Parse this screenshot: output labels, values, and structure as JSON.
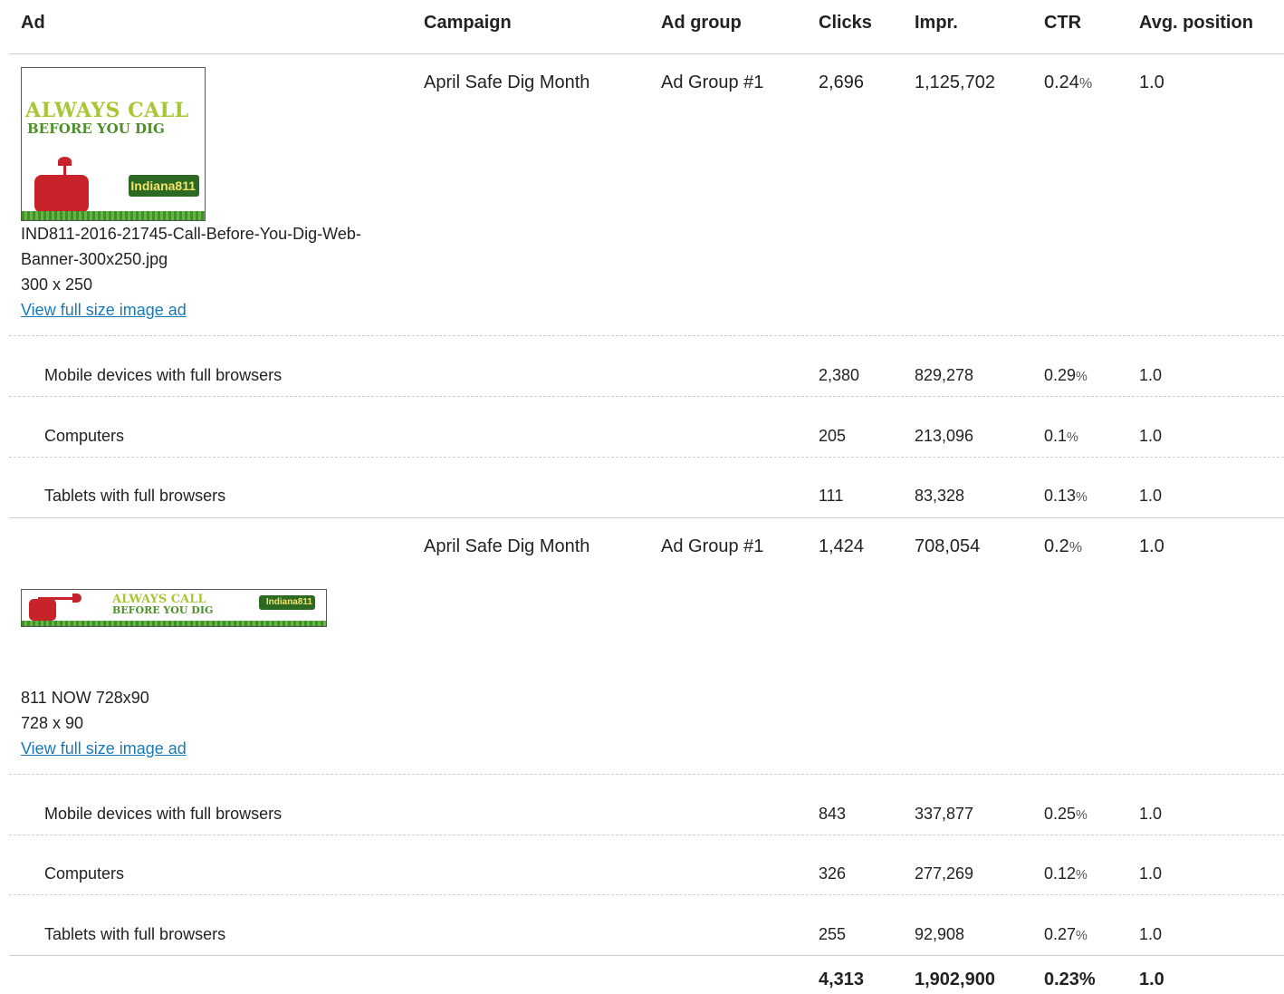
{
  "headers": {
    "ad": "Ad",
    "campaign": "Campaign",
    "ad_group": "Ad group",
    "clicks": "Clicks",
    "impr": "Impr.",
    "ctr": "CTR",
    "avg_position": "Avg. position"
  },
  "ads": [
    {
      "banner_text_1": "ALWAYS CALL",
      "banner_text_2": "BEFORE YOU DIG",
      "brand": "Indiana811",
      "filename": "IND811-2016-21745-Call-Before-You-Dig-Web-Banner-300x250.jpg",
      "dimensions": "300 x 250",
      "link_label": "View full size image ad",
      "campaign": "April Safe Dig Month",
      "ad_group": "Ad Group #1",
      "clicks": "2,696",
      "impr": "1,125,702",
      "ctr": "0.24",
      "avg_position": "1.0",
      "segments": [
        {
          "label": "Mobile devices with full browsers",
          "clicks": "2,380",
          "impr": "829,278",
          "ctr": "0.29",
          "avg_position": "1.0"
        },
        {
          "label": "Computers",
          "clicks": "205",
          "impr": "213,096",
          "ctr": "0.1",
          "avg_position": "1.0"
        },
        {
          "label": "Tablets with full browsers",
          "clicks": "111",
          "impr": "83,328",
          "ctr": "0.13",
          "avg_position": "1.0"
        }
      ]
    },
    {
      "banner_text_1": "ALWAYS CALL",
      "banner_text_2": "BEFORE YOU DIG",
      "brand": "Indiana811",
      "filename": "811 NOW 728x90",
      "dimensions": "728 x 90",
      "link_label": "View full size image ad",
      "campaign": "April Safe Dig Month",
      "ad_group": "Ad Group #1",
      "clicks": "1,424",
      "impr": "708,054",
      "ctr": "0.2",
      "avg_position": "1.0",
      "segments": [
        {
          "label": "Mobile devices with full browsers",
          "clicks": "843",
          "impr": "337,877",
          "ctr": "0.25",
          "avg_position": "1.0"
        },
        {
          "label": "Computers",
          "clicks": "326",
          "impr": "277,269",
          "ctr": "0.12",
          "avg_position": "1.0"
        },
        {
          "label": "Tablets with full browsers",
          "clicks": "255",
          "impr": "92,908",
          "ctr": "0.27",
          "avg_position": "1.0"
        }
      ]
    }
  ],
  "percent_sign": "%",
  "totals": {
    "clicks": "4,313",
    "impr": "1,902,900",
    "ctr": "0.23%",
    "avg_position": "1.0"
  },
  "colors": {
    "link": "#1a7ab8",
    "banner_green_light": "#a7c735",
    "banner_green_dark": "#4f8e2c",
    "tank_red": "#c8232a"
  }
}
